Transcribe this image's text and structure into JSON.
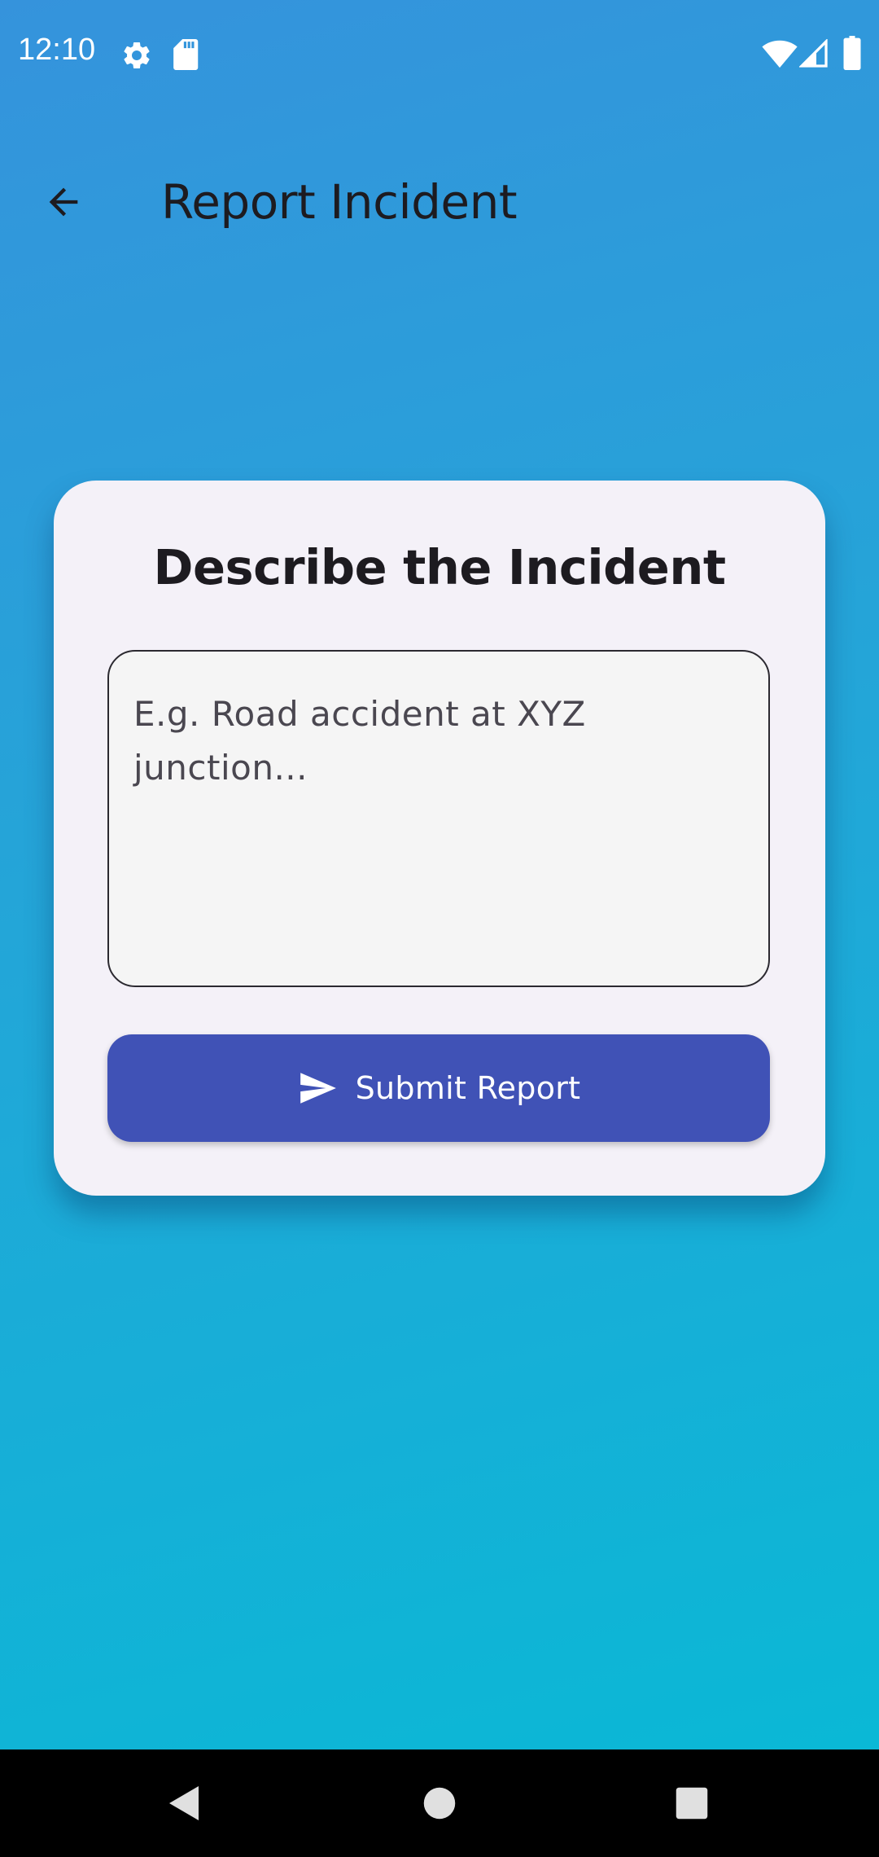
{
  "status_bar": {
    "time": "12:10",
    "icons": [
      "settings-icon",
      "sd-card-icon",
      "wifi-icon",
      "cellular-signal-icon",
      "battery-icon"
    ]
  },
  "app_bar": {
    "back_icon": "arrow-back-icon",
    "title": "Report Incident"
  },
  "card": {
    "title": "Describe the Incident",
    "description_field": {
      "value": "",
      "placeholder": "E.g. Road accident at XYZ junction..."
    },
    "submit_button": {
      "icon": "send-icon",
      "label": "Submit Report"
    }
  },
  "nav_bar": {
    "buttons": [
      "back-triangle-icon",
      "home-circle-icon",
      "recents-square-icon"
    ]
  },
  "colors": {
    "gradient_top": "#3593dc",
    "gradient_bottom": "#0ab8d6",
    "card_background": "#f4f1f8",
    "button_background": "#4052b6",
    "title_text": "#1d1b20"
  }
}
